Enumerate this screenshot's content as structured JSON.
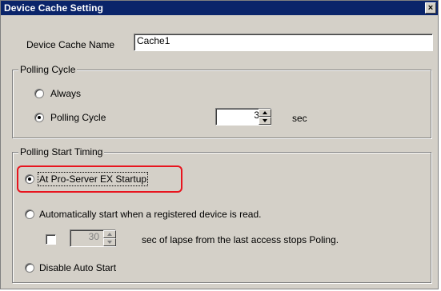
{
  "window": {
    "title": "Device Cache Setting",
    "close_glyph": "×"
  },
  "device_cache_name": {
    "label": "Device Cache Name",
    "value": "Cache1"
  },
  "polling_cycle": {
    "group_title": "Polling Cycle",
    "options": [
      {
        "label": "Always",
        "selected": false
      },
      {
        "label": "Polling Cycle",
        "selected": true
      }
    ],
    "cycle_value": "3.0",
    "cycle_unit": "sec"
  },
  "polling_start_timing": {
    "group_title": "Polling Start Timing",
    "options": [
      {
        "label": "At Pro-Server EX Startup",
        "selected": true
      },
      {
        "label": "Automatically start when a registered device is read.",
        "selected": false
      },
      {
        "label": "Disable Auto Start",
        "selected": false
      }
    ],
    "lapse_value": "30",
    "lapse_checked": false,
    "lapse_text": "sec of lapse from the last access stops Poling."
  },
  "colors": {
    "titlebar": "#0a246a",
    "dialog_bg": "#d4d0c8",
    "highlight": "#e8141e"
  }
}
